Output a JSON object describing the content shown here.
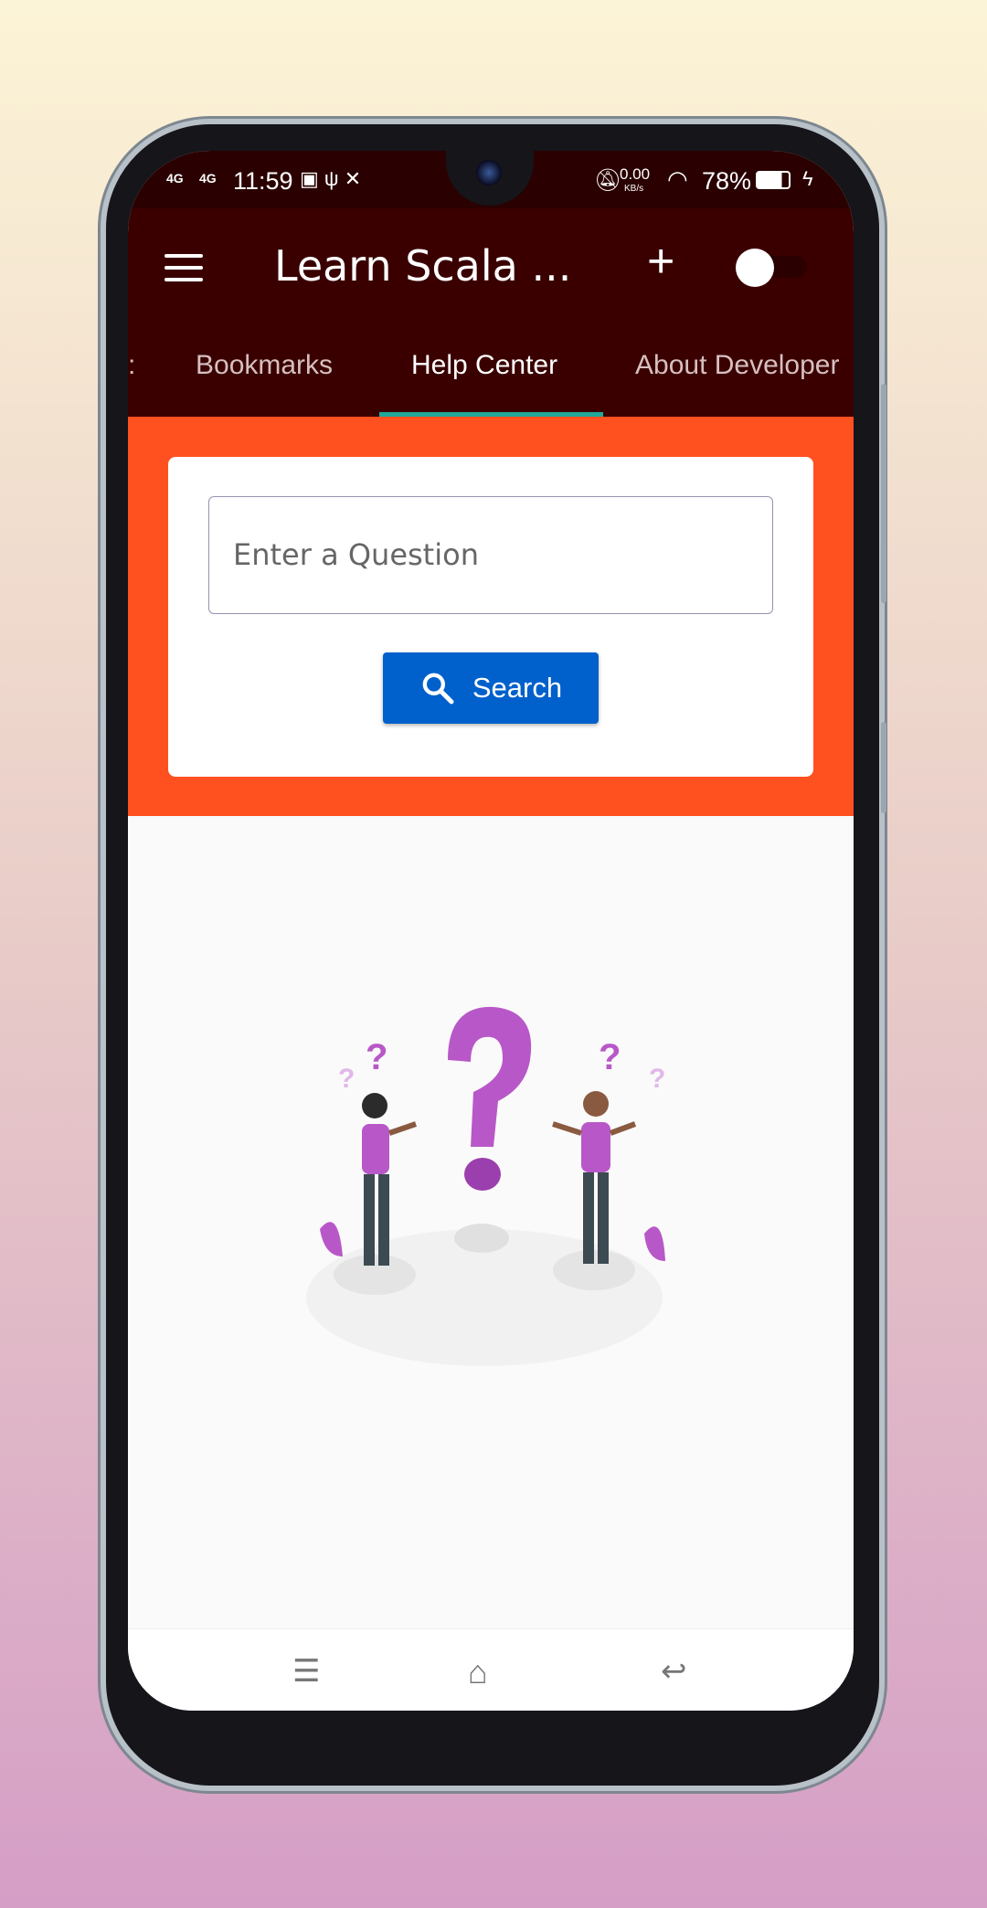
{
  "status_bar": {
    "signal1": "4G",
    "signal2": "4G",
    "time": "11:59",
    "net_speed": "0.00",
    "net_unit": "KB/s",
    "battery": "78%",
    "icons": [
      "signal-icon",
      "usb-icon",
      "tools-icon",
      "bell-off-icon",
      "wifi-icon",
      "battery-icon",
      "charging-icon"
    ]
  },
  "app_bar": {
    "title": "Learn Scala ...",
    "toggle_on": false
  },
  "tabs": [
    {
      "label": "Bookmarks"
    },
    {
      "label": "Help Center",
      "active": true
    },
    {
      "label": "About Developer"
    }
  ],
  "search": {
    "placeholder": "Enter a Question",
    "value": "",
    "button_label": "Search"
  },
  "colors": {
    "app_bar": "#3a0000",
    "accent": "#ff5020",
    "button": "#0060cc",
    "tab_indicator": "#1fa899"
  }
}
